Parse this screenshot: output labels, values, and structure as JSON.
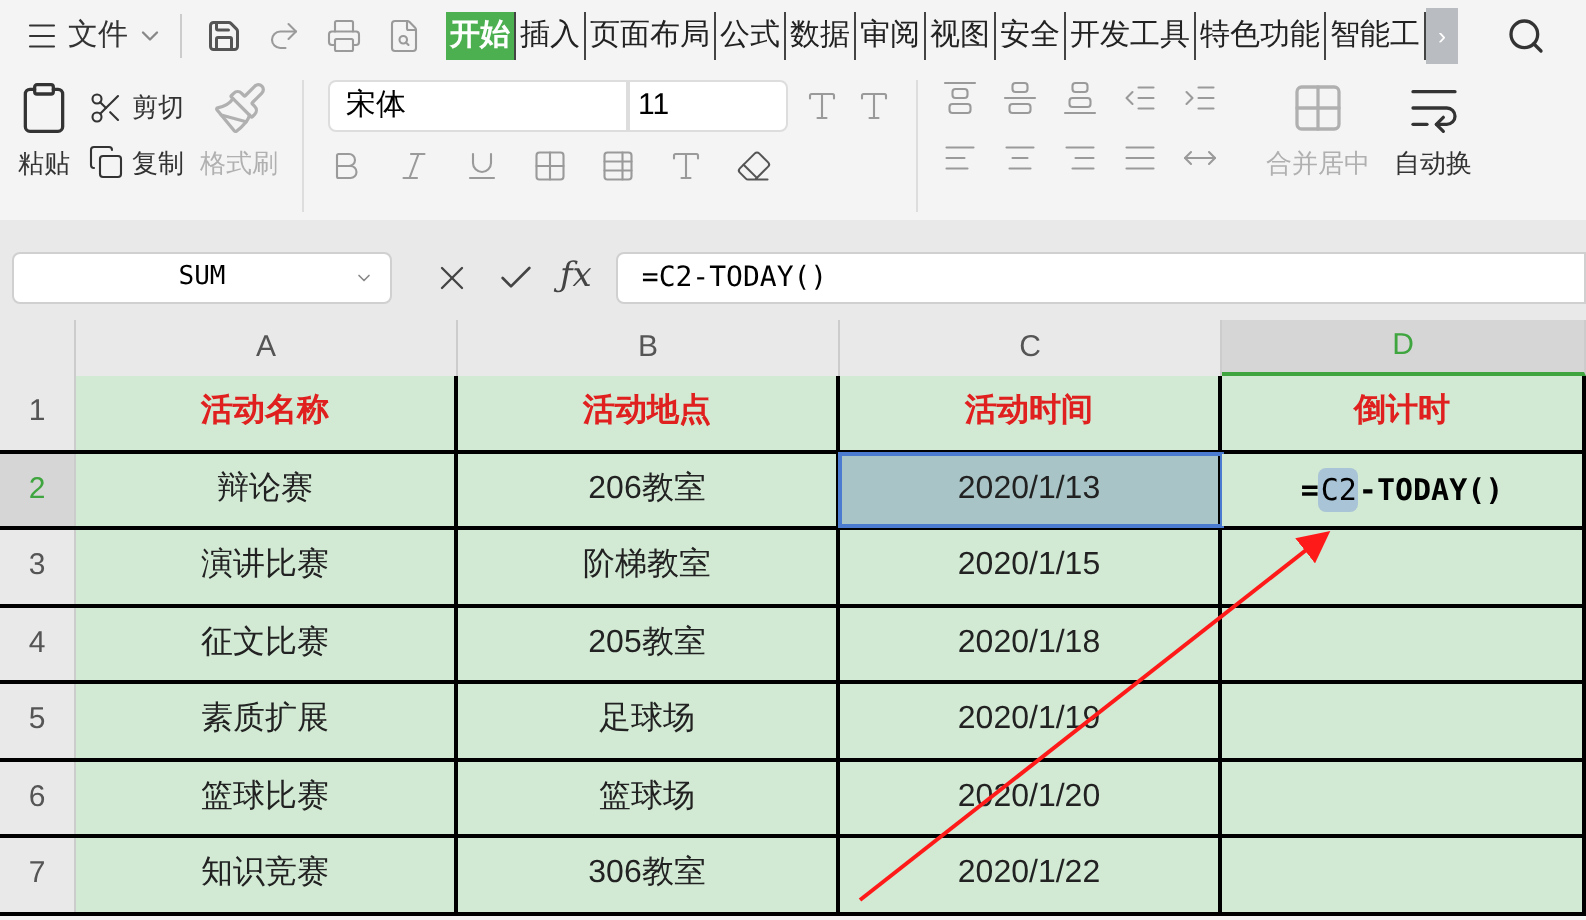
{
  "menu": {
    "label": "文件"
  },
  "tabs": [
    {
      "label": "开始",
      "selected": true
    },
    {
      "label": "插入",
      "selected": false
    },
    {
      "label": "页面布局",
      "selected": false
    },
    {
      "label": "公式",
      "selected": false
    },
    {
      "label": "数据",
      "selected": false
    },
    {
      "label": "审阅",
      "selected": false
    },
    {
      "label": "视图",
      "selected": false
    },
    {
      "label": "安全",
      "selected": false
    },
    {
      "label": "开发工具",
      "selected": false
    },
    {
      "label": "特色功能",
      "selected": false
    },
    {
      "label": "智能工",
      "selected": false
    }
  ],
  "tabs_more": "›",
  "ribbon": {
    "paste": {
      "label": "粘贴",
      "disabled": false
    },
    "cut": {
      "label": "剪切",
      "disabled": false
    },
    "copy": {
      "label": "复制",
      "disabled": false
    },
    "format_painter": {
      "label": "格式刷",
      "disabled": true
    },
    "font": "宋体",
    "font_size": "11",
    "merge": {
      "label": "合并居中",
      "disabled": true
    },
    "wrap": {
      "label": "自动换",
      "disabled": false
    }
  },
  "formula_bar": {
    "name_box": "SUM",
    "fx": "ƒx",
    "formula": "=C2-TODAY()"
  },
  "columns": [
    {
      "label": "A",
      "selected": false
    },
    {
      "label": "B",
      "selected": false
    },
    {
      "label": "C",
      "selected": false
    },
    {
      "label": "D",
      "selected": true
    }
  ],
  "rows": [
    {
      "label": "1",
      "selected": false,
      "kind": "header",
      "cells": [
        {
          "text": "活动名称"
        },
        {
          "text": "活动地点"
        },
        {
          "text": "活动时间"
        },
        {
          "text": "倒计时"
        }
      ]
    },
    {
      "label": "2",
      "selected": true,
      "kind": "data",
      "cells": [
        {
          "text": "辩论赛"
        },
        {
          "text": "206教室"
        },
        {
          "text": "2020/1/13",
          "selected": true
        },
        {
          "kind": "formula",
          "prefix": "=",
          "ref": "C2",
          "suffix": "-TODAY()"
        }
      ]
    },
    {
      "label": "3",
      "selected": false,
      "kind": "data",
      "cells": [
        {
          "text": "演讲比赛"
        },
        {
          "text": "阶梯教室"
        },
        {
          "text": "2020/1/15"
        },
        {}
      ]
    },
    {
      "label": "4",
      "selected": false,
      "kind": "data",
      "cells": [
        {
          "text": "征文比赛"
        },
        {
          "text": "205教室"
        },
        {
          "text": "2020/1/18"
        },
        {}
      ]
    },
    {
      "label": "5",
      "selected": false,
      "kind": "data",
      "cells": [
        {
          "text": "素质扩展"
        },
        {
          "text": "足球场"
        },
        {
          "text": "2020/1/19"
        },
        {}
      ]
    },
    {
      "label": "6",
      "selected": false,
      "kind": "data",
      "cells": [
        {
          "text": "篮球比赛"
        },
        {
          "text": "篮球场"
        },
        {
          "text": "2020/1/20"
        },
        {}
      ]
    },
    {
      "label": "7",
      "selected": false,
      "kind": "data",
      "cells": [
        {
          "text": "知识竞赛"
        },
        {
          "text": "306教室"
        },
        {
          "text": "2020/1/22"
        },
        {}
      ]
    }
  ]
}
